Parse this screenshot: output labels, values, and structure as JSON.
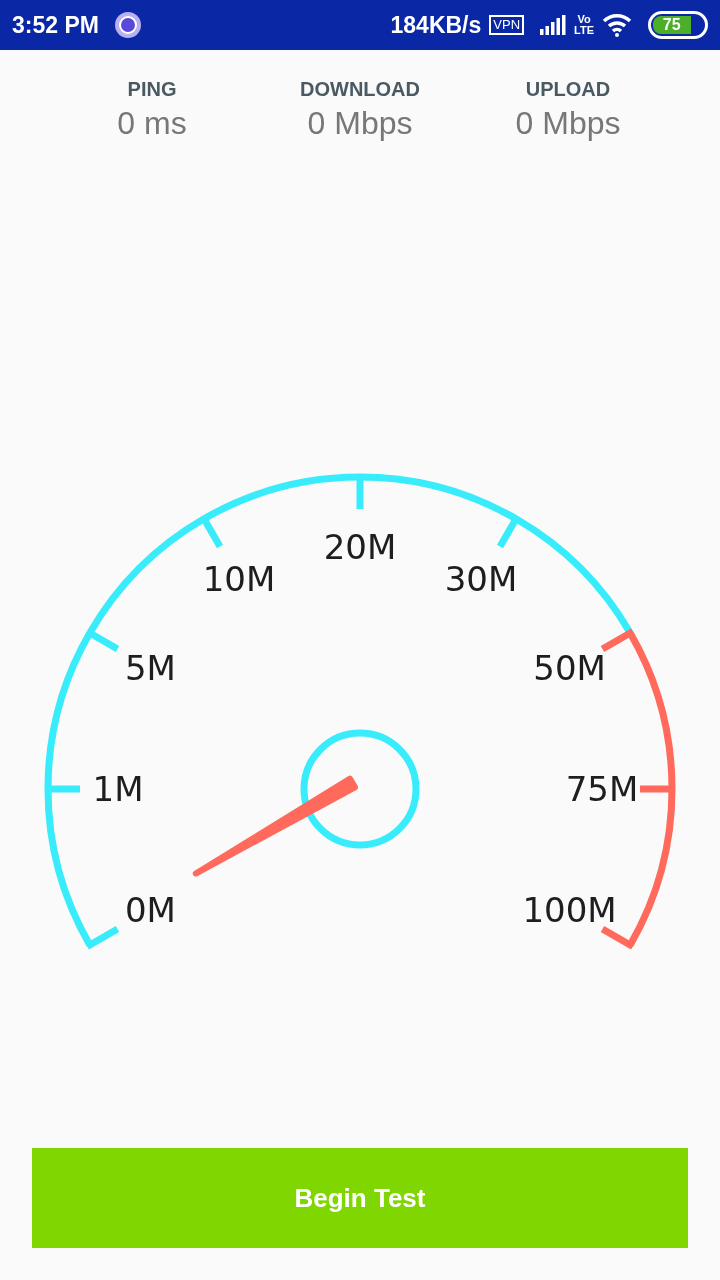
{
  "status_bar": {
    "time": "3:52 PM",
    "speed": "184KB/s",
    "vpn_badge": "VPN",
    "volte": "Vo",
    "lte": "LTE",
    "battery": "75"
  },
  "stats": [
    {
      "label": "PING",
      "value": "0 ms"
    },
    {
      "label": "DOWNLOAD",
      "value": "0 Mbps"
    },
    {
      "label": "UPLOAD",
      "value": "0 Mbps"
    }
  ],
  "gauge": {
    "ticks": [
      {
        "label": "0M",
        "color": "#38ecfb"
      },
      {
        "label": "1M",
        "color": "#38ecfb"
      },
      {
        "label": "5M",
        "color": "#38ecfb"
      },
      {
        "label": "10M",
        "color": "#38ecfb"
      },
      {
        "label": "20M",
        "color": "#38ecfb"
      },
      {
        "label": "30M",
        "color": "#38ecfb"
      },
      {
        "label": "50M",
        "color": "#ff6a5c"
      },
      {
        "label": "75M",
        "color": "#ff6a5c"
      },
      {
        "label": "100M",
        "color": "#ff6a5c"
      }
    ]
  },
  "button": "Begin Test"
}
